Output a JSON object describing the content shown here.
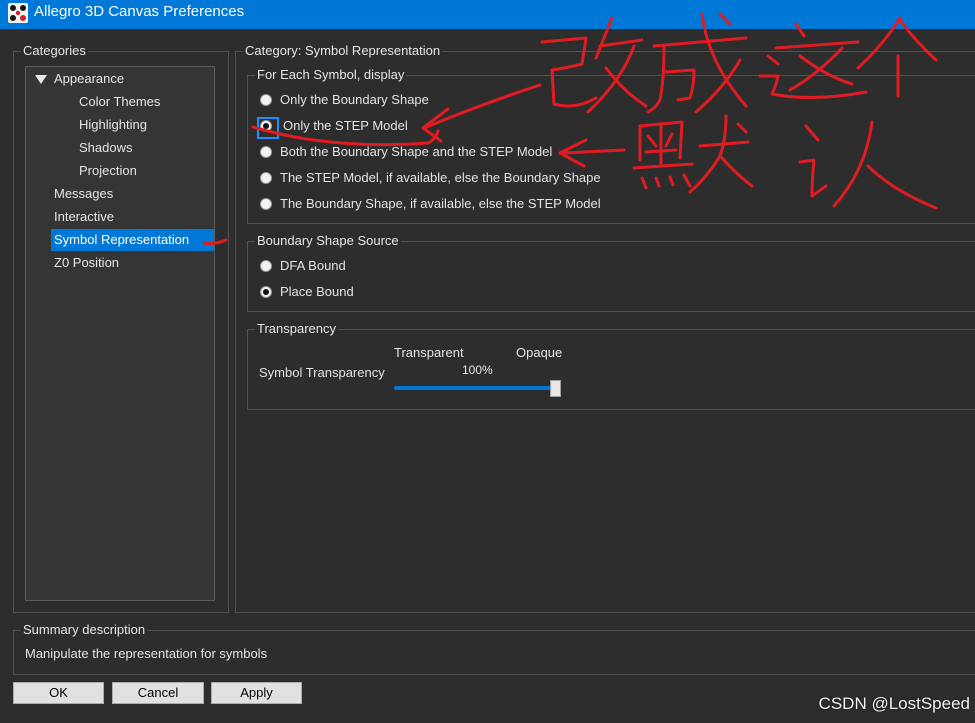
{
  "window": {
    "title": "Allegro 3D Canvas Preferences"
  },
  "icons": {
    "app": "app-icon",
    "expander": "triangle-down-icon",
    "radio": "radio-button-icon"
  },
  "colors": {
    "accent": "#0078d7",
    "background": "#2d2d2d",
    "annotation": "#e11b22"
  },
  "categories": {
    "label": "Categories",
    "items": [
      {
        "label": "Appearance",
        "level": 0,
        "expanded": true,
        "selected": false
      },
      {
        "label": "Color Themes",
        "level": 1,
        "selected": false
      },
      {
        "label": "Highlighting",
        "level": 1,
        "selected": false
      },
      {
        "label": "Shadows",
        "level": 1,
        "selected": false
      },
      {
        "label": "Projection",
        "level": 1,
        "selected": false
      },
      {
        "label": "Messages",
        "level": 0,
        "selected": false
      },
      {
        "label": "Interactive",
        "level": 0,
        "selected": false
      },
      {
        "label": "Symbol Representation",
        "level": 0,
        "selected": true
      },
      {
        "label": "Z0 Position",
        "level": 0,
        "selected": false
      }
    ]
  },
  "panel": {
    "title": "Category: Symbol Representation",
    "display_group": {
      "label": "For Each Symbol, display",
      "options": [
        {
          "label": "Only the Boundary Shape",
          "checked": false,
          "focused": false
        },
        {
          "label": "Only the STEP Model",
          "checked": true,
          "focused": true
        },
        {
          "label": "Both the Boundary Shape and the STEP Model",
          "checked": false,
          "focused": false
        },
        {
          "label": "The STEP Model, if available, else the Boundary Shape",
          "checked": false,
          "focused": false
        },
        {
          "label": "The Boundary Shape, if available, else the STEP Model",
          "checked": false,
          "focused": false
        }
      ]
    },
    "source_group": {
      "label": "Boundary Shape Source",
      "options": [
        {
          "label": "DFA Bound",
          "checked": false
        },
        {
          "label": "Place Bound",
          "checked": true
        }
      ]
    },
    "transparency_group": {
      "label": "Transparency",
      "row_label": "Symbol Transparency",
      "min_label": "Transparent",
      "max_label": "Opaque",
      "value_text": "100%",
      "value": 100
    }
  },
  "summary": {
    "label": "Summary description",
    "text": "Manipulate the representation for symbols"
  },
  "buttons": {
    "ok": "OK",
    "cancel": "Cancel",
    "apply": "Apply"
  },
  "watermark": "CSDN @LostSpeed",
  "annotations": {
    "top_note": "改成这个",
    "side_note": "默认"
  }
}
